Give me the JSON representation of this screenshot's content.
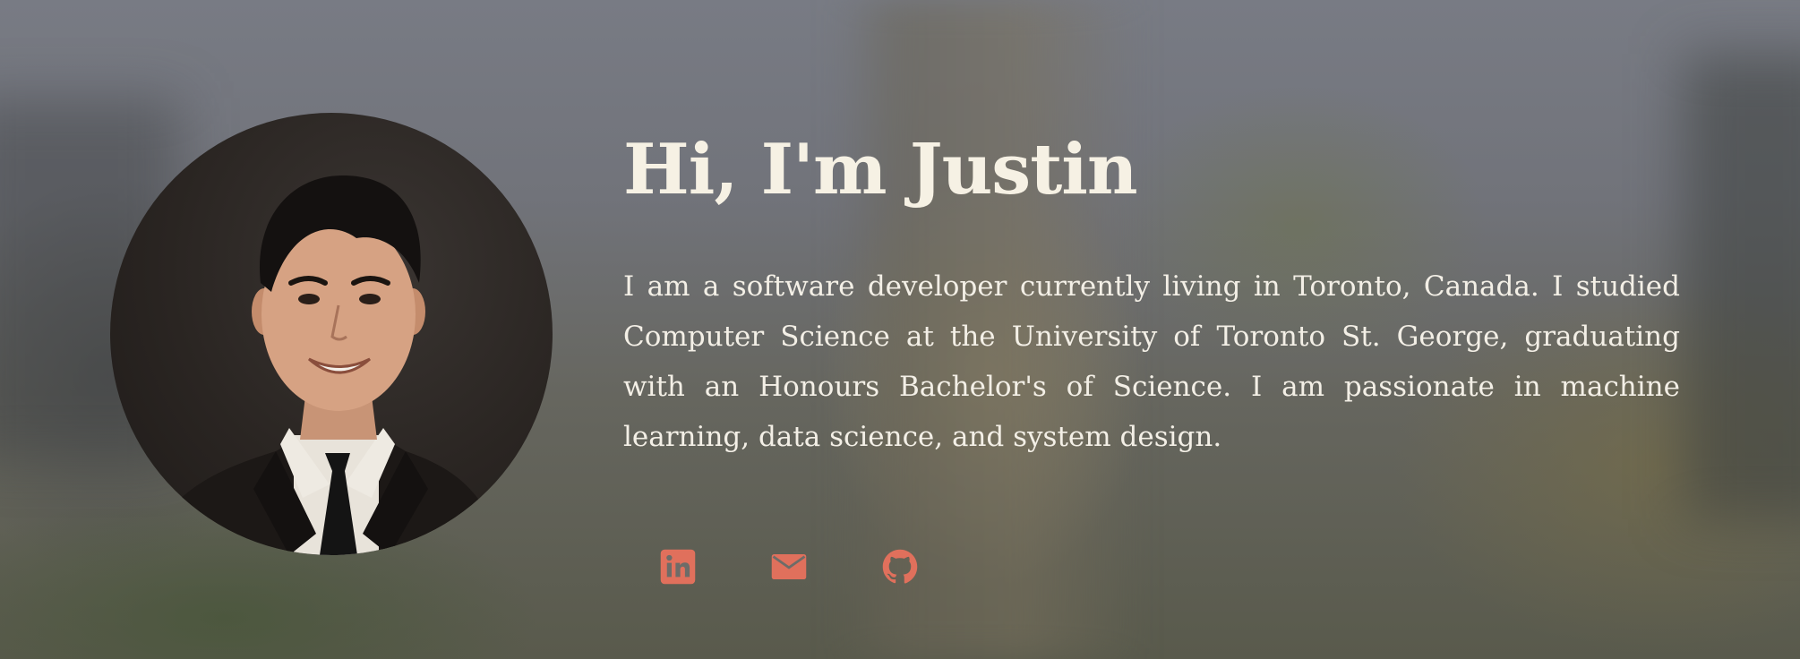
{
  "hero": {
    "title": "Hi, I'm Justin",
    "bio": "I am a software developer currently living in Toronto, Canada. I studied Computer Science at the University of Toronto St. George, graduating with an Honours Bachelor's of Science. I am passionate in machine learning, data science, and system design."
  },
  "avatar": {
    "alt": "Portrait photo of Justin"
  },
  "socials": [
    {
      "icon": "linkedin-icon",
      "label": "LinkedIn"
    },
    {
      "icon": "mail-icon",
      "label": "Email"
    },
    {
      "icon": "github-icon",
      "label": "GitHub"
    }
  ],
  "colors": {
    "accent": "#e0705c",
    "text": "#f3efe6"
  }
}
